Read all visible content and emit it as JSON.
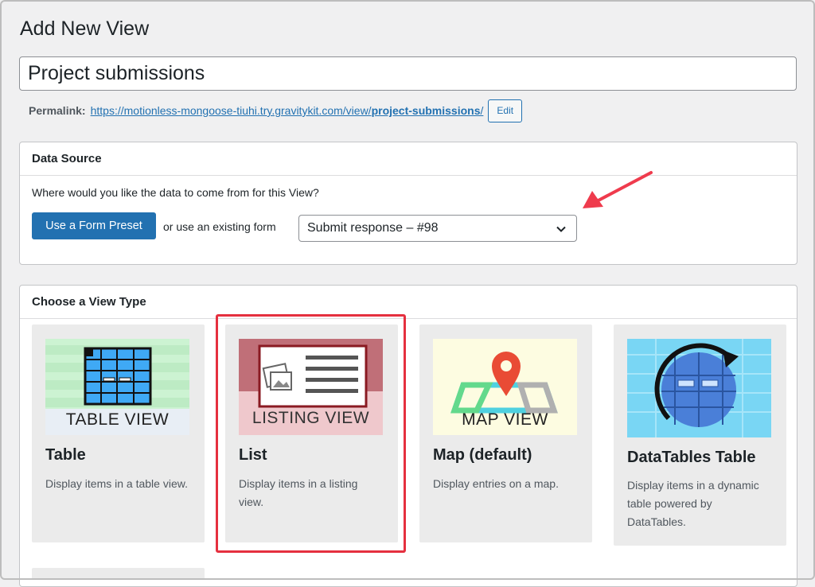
{
  "page": {
    "title": "Add New View"
  },
  "view_title": {
    "value": "Project submissions"
  },
  "permalink": {
    "label": "Permalink:",
    "url_base": "https://motionless-mongoose-tiuhi.try.gravitykit.com/view/",
    "url_slug": "project-submissions",
    "url_end": "/",
    "edit_label": "Edit"
  },
  "data_source": {
    "heading": "Data Source",
    "question": "Where would you like the data to come from for this View?",
    "preset_button": "Use a Form Preset",
    "or_text": "or use an existing form",
    "selected_form": "Submit response – #98"
  },
  "view_type": {
    "heading": "Choose a View Type",
    "cards": [
      {
        "name": "Table",
        "description": "Display items in a table view.",
        "thumb_caption": "TABLE VIEW"
      },
      {
        "name": "List",
        "description": "Display items in a listing view.",
        "thumb_caption": "LISTING VIEW"
      },
      {
        "name": "Map (default)",
        "description": "Display entries on a map.",
        "thumb_caption": "MAP VIEW"
      },
      {
        "name": "DataTables Table",
        "description": "Display items in a dynamic table powered by DataTables.",
        "thumb_caption": ""
      }
    ]
  },
  "colors": {
    "primary": "#2271b1",
    "highlight": "#e5303f",
    "annotation_arrow": "#ef3b4d"
  }
}
